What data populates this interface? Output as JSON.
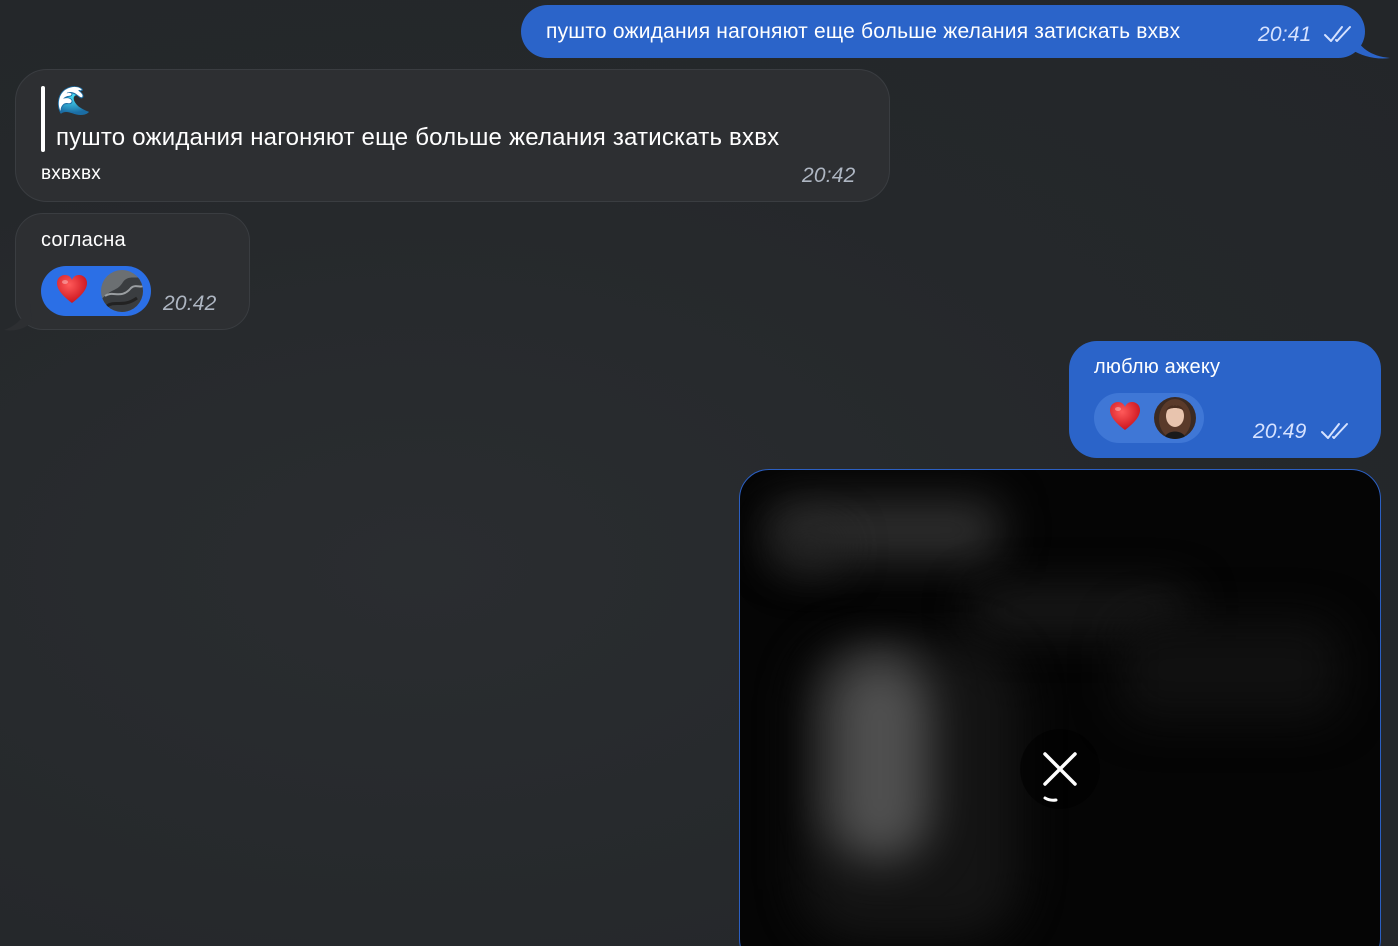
{
  "messages": {
    "m1": {
      "text": "пушто ожидания нагоняют еще больше желания затискать вхвх",
      "time": "20:41",
      "status": "read"
    },
    "m2": {
      "quote_emoji": "🌊",
      "quote_text": "пушто ожидания нагоняют еще больше желания затискать вхвх",
      "text": "вхвхвх",
      "time": "20:42"
    },
    "m3": {
      "text": "согласна",
      "reaction_emoji": "heart",
      "time": "20:42"
    },
    "m4": {
      "text": "люблю ажеку",
      "reaction_emoji": "heart",
      "time": "20:49",
      "status": "read"
    },
    "m5": {
      "type": "media",
      "state": "loading",
      "action_icon": "close-icon"
    }
  },
  "colors": {
    "background": "#25282b",
    "outgoing_bubble": "#2b64c9",
    "incoming_bubble": "#2d2f32",
    "reaction_chosen": "#2b6fe6"
  }
}
